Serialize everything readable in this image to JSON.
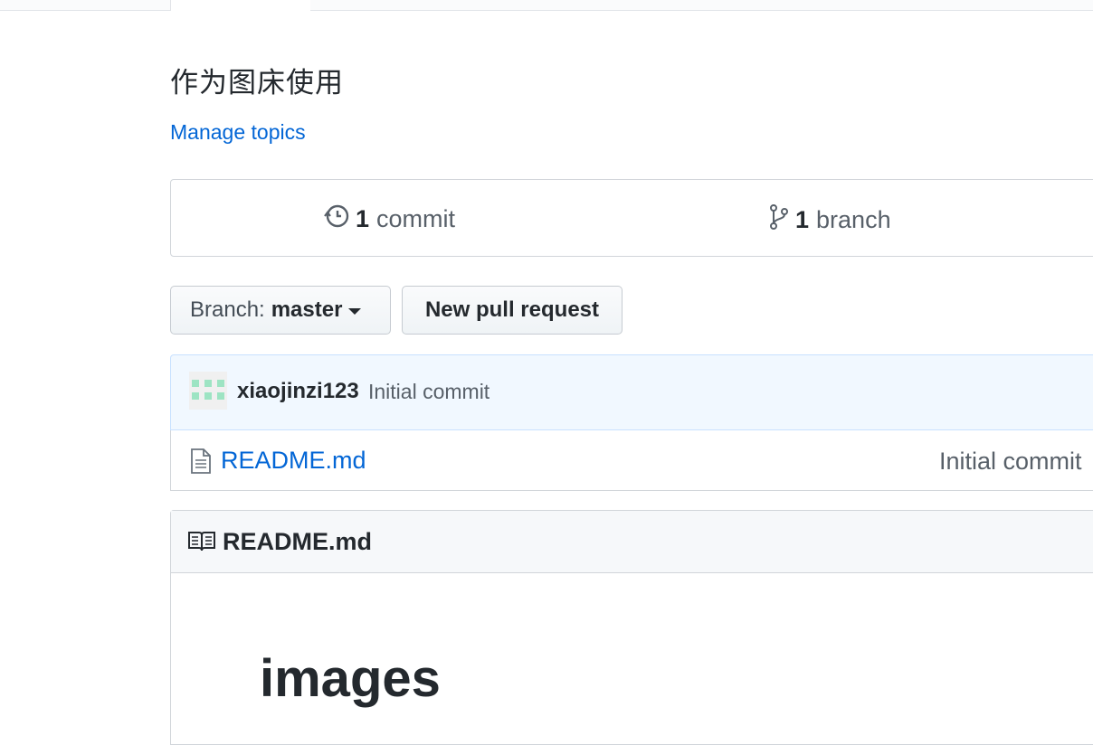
{
  "repo": {
    "description": "作为图床使用",
    "manage_topics": "Manage topics"
  },
  "numbers_summary": {
    "commits": {
      "count": "1",
      "label": "commit",
      "icon": "history-icon"
    },
    "branches": {
      "count": "1",
      "label": "branch",
      "icon": "git-branch-icon"
    }
  },
  "toolbar": {
    "branch_prefix": "Branch:",
    "branch_name": "master",
    "new_pull_request": "New pull request"
  },
  "latest_commit": {
    "author": "xiaojinzi123",
    "message": "Initial commit",
    "avatar_color": "#9de4c3"
  },
  "files": [
    {
      "name": "README.md",
      "icon": "file-icon",
      "last_commit": "Initial commit"
    }
  ],
  "readme": {
    "title": "README.md",
    "icon": "book-icon",
    "heading": "images"
  },
  "colors": {
    "link": "#0366d6",
    "text": "#24292e",
    "muted": "#586069",
    "border": "#d1d5da",
    "commit_bg": "#f1f8ff"
  }
}
